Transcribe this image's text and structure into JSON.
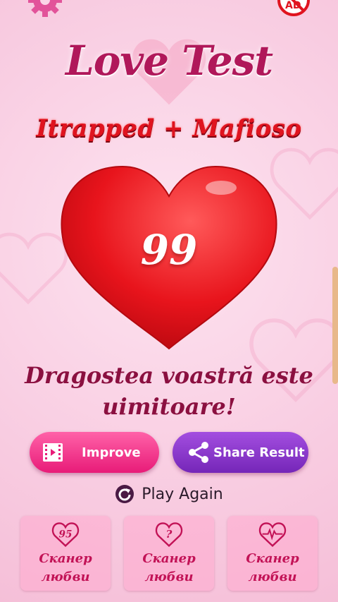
{
  "app": {
    "title": "Love Test",
    "names": "Itrapped + Mafioso",
    "score": "99",
    "message": "Dragostea voastră este uimitoare!"
  },
  "top_bar": {
    "settings_icon": "gear-icon",
    "ad_label": "AD"
  },
  "buttons": {
    "improve_label": "Improve",
    "share_label": "Share Result",
    "play_again_label": "Play Again"
  },
  "cards": [
    {
      "badge": "95",
      "label": "Сканер\nлюбви",
      "icon": "heart-95-icon"
    },
    {
      "badge": "?",
      "label": "Сканер\nлюбви",
      "icon": "heart-question-icon"
    },
    {
      "badge": "",
      "label": "Сканер\nлюбви",
      "icon": "heart-pulse-icon"
    }
  ],
  "colors": {
    "title": "#b0185a",
    "names": "#e0141f",
    "heart": "#e8141c",
    "improve": "#e81b78",
    "share": "#7526b8"
  }
}
